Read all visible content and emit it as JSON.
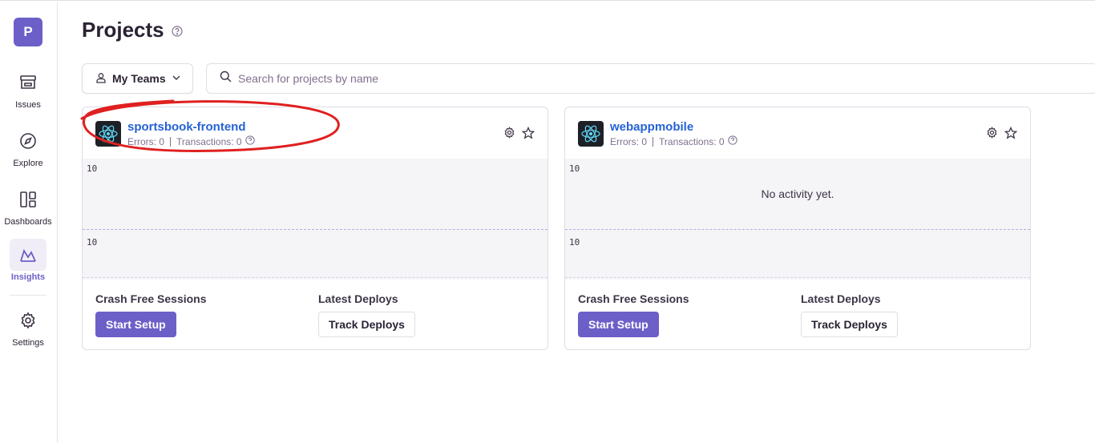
{
  "org": {
    "initial": "P"
  },
  "nav": {
    "issues": "Issues",
    "explore": "Explore",
    "dashboards": "Dashboards",
    "insights": "Insights",
    "settings": "Settings"
  },
  "header": {
    "title": "Projects"
  },
  "filters": {
    "teams_label": "My Teams",
    "search_placeholder": "Search for projects by name"
  },
  "projects": [
    {
      "name": "sportsbook-frontend",
      "errors": "Errors: 0",
      "transactions": "Transactions: 0",
      "chart_top": "10",
      "chart_bottom": "10",
      "no_activity": "",
      "crash_free_title": "Crash Free Sessions",
      "start_setup": "Start Setup",
      "deploys_title": "Latest Deploys",
      "track_deploys": "Track Deploys"
    },
    {
      "name": "webappmobile",
      "errors": "Errors: 0",
      "transactions": "Transactions: 0",
      "chart_top": "10",
      "chart_bottom": "10",
      "no_activity": "No activity yet.",
      "crash_free_title": "Crash Free Sessions",
      "start_setup": "Start Setup",
      "deploys_title": "Latest Deploys",
      "track_deploys": "Track Deploys"
    }
  ],
  "colors": {
    "accent": "#6c5fc7",
    "link": "#2562d4",
    "annotation": "#e02020"
  },
  "icons": [
    "issues-icon",
    "explore-icon",
    "dashboards-icon",
    "insights-icon",
    "settings-icon",
    "help-icon",
    "user-icon",
    "chevron-down-icon",
    "search-icon",
    "react-icon",
    "gear-icon",
    "star-icon"
  ]
}
